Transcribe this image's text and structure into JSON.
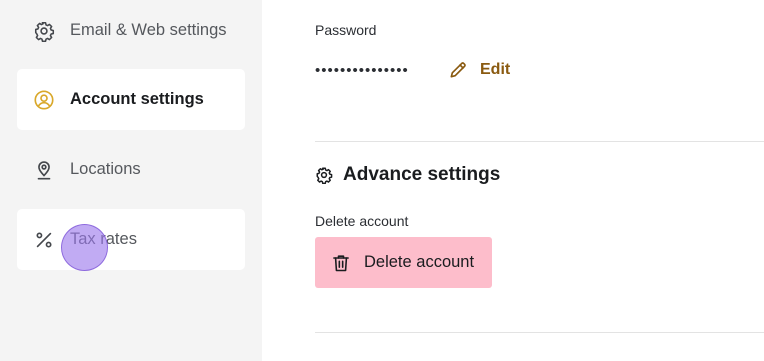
{
  "sidebar": {
    "items": [
      {
        "label": "Email & Web settings",
        "icon": "gear-icon",
        "state": "default"
      },
      {
        "label": "Account settings",
        "icon": "user-circle-icon",
        "state": "active"
      },
      {
        "label": "Locations",
        "icon": "location-pin-icon",
        "state": "default"
      },
      {
        "label": "Tax rates",
        "icon": "percent-icon",
        "state": "hovered"
      }
    ]
  },
  "password": {
    "label": "Password",
    "masked_value": "•••••••••••••••",
    "edit_label": "Edit"
  },
  "advance": {
    "title": "Advance settings",
    "delete_label": "Delete account",
    "delete_button": "Delete account"
  },
  "colors": {
    "sidebar_bg": "#f4f4f4",
    "accent_brown": "#8a5a10",
    "account_icon": "#d9a82a",
    "delete_button_bg": "#fdbdcb",
    "cursor": "#9b78eb"
  }
}
